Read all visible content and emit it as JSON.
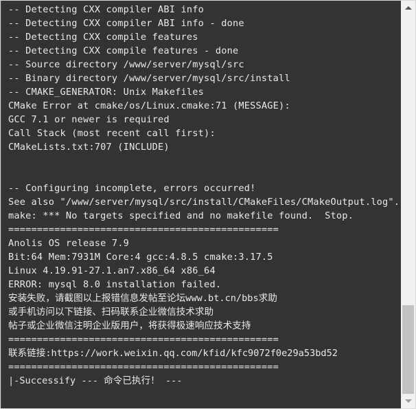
{
  "window": {
    "type": "terminal-console",
    "background_color": "#333333",
    "text_color": "#e9e9e9",
    "chrome_color": "#f1f1f1"
  },
  "console": {
    "lines": [
      "-- Detecting CXX compiler ABI info",
      "-- Detecting CXX compiler ABI info - done",
      "-- Detecting CXX compile features",
      "-- Detecting CXX compile features - done",
      "-- Source directory /www/server/mysql/src",
      "-- Binary directory /www/server/mysql/src/install",
      "-- CMAKE_GENERATOR: Unix Makefiles",
      "CMake Error at cmake/os/Linux.cmake:71 (MESSAGE):",
      "GCC 7.1 or newer is required",
      "Call Stack (most recent call first):",
      "CMakeLists.txt:707 (INCLUDE)",
      "",
      "",
      "-- Configuring incomplete, errors occurred!",
      "See also \"/www/server/mysql/src/install/CMakeFiles/CMakeOutput.log\".",
      "make: *** No targets specified and no makefile found.  Stop.",
      "===============================================",
      "Anolis OS release 7.9",
      "Bit:64 Mem:7931M Core:4 gcc:4.8.5 cmake:3.17.5",
      "Linux 4.19.91-27.1.an7.x86_64 x86_64",
      "ERROR: mysql 8.0 installation failed.",
      "安装失败，请截图以上报错信息发帖至论坛www.bt.cn/bbs求助",
      "或手机访问以下链接、扫码联系企业微信技术求助",
      "帖子或企业微信注明企业版用户，将获得极速响应技术支持",
      "===============================================",
      "联系链接:https://work.weixin.qq.com/kfid/kfc9072f0e29a53bd52",
      "===============================================",
      "|-Successify --- 命令已执行！ ---"
    ]
  },
  "scrollbar": {
    "up_arrow": "scroll-up-arrow",
    "down_arrow": "scroll-down-arrow",
    "thumb_label": "scrollbar-thumb"
  }
}
